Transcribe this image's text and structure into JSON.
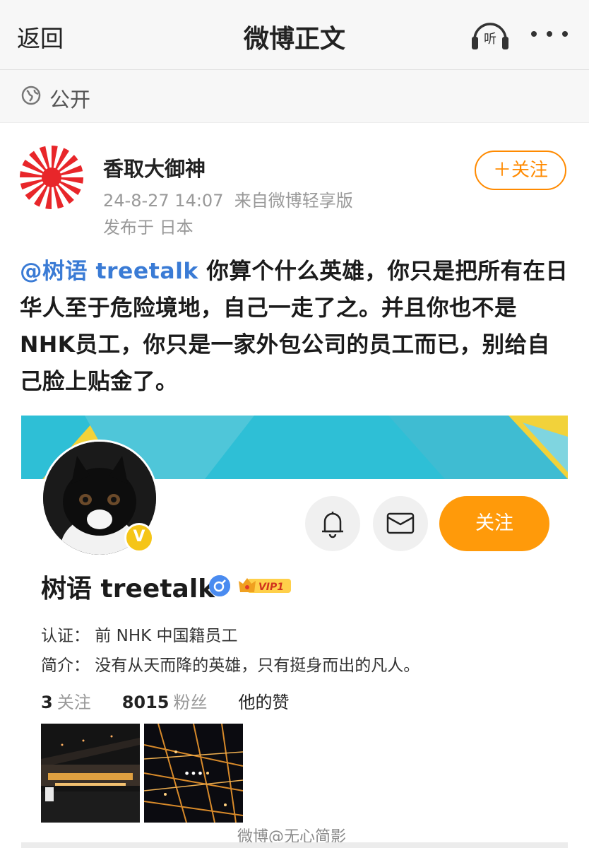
{
  "header": {
    "back_label": "返回",
    "title": "微博正文",
    "listen_label": "听",
    "listen_icon": "headphone-icon",
    "more_icon": "more-dots-icon"
  },
  "visibility": {
    "icon": "globe-icon",
    "label": "公开"
  },
  "post": {
    "author_name": "香取大御神",
    "timestamp": "24-8-27 14:07",
    "source": "来自微博轻享版",
    "location": "发布于 日本",
    "follow_label": "＋关注",
    "mention": "@树语 treetalk",
    "body": " 你算个什么英雄，你只是把所有在日华人至于危险境地，自己一走了之。并且你也不是NHK员工，你只是一家外包公司的员工而已，别给自己脸上贴金了。"
  },
  "profile_card": {
    "name": "树语 treetalk",
    "avatar_badge": "V",
    "vip_label": "VIP1",
    "follow_label": "关注",
    "certification": "认证：  前 NHK 中国籍员工",
    "bio": "简介：  没有从天而降的英雄，只有挺身而出的凡人。",
    "following_count": "3",
    "following_label": "关注",
    "followers_count": "8015",
    "followers_label": "粉丝",
    "likes_label": "他的赞",
    "more_photos_label": "•••"
  },
  "watermark": "微博@无心简影",
  "colors": {
    "accent_orange": "#ff9a0a",
    "link_blue": "#3a7bd5",
    "banner_cyan": "#2ebfd6",
    "banner_yellow": "#f2d23a"
  }
}
